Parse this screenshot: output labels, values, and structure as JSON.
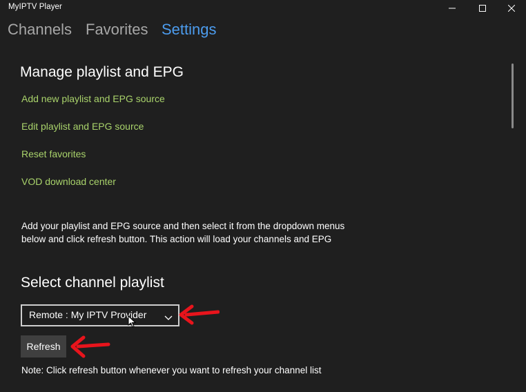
{
  "window": {
    "title": "MyIPTV Player",
    "controls": [
      "minimize-icon",
      "maximize-icon",
      "close-icon"
    ]
  },
  "nav": {
    "tabs": [
      {
        "label": "Channels",
        "active": false
      },
      {
        "label": "Favorites",
        "active": false
      },
      {
        "label": "Settings",
        "active": true
      }
    ]
  },
  "manage": {
    "title": "Manage playlist and EPG",
    "links": [
      "Add new playlist and EPG source",
      "Edit playlist and EPG source",
      "Reset favorites",
      "VOD download center"
    ]
  },
  "info": {
    "text": "Add your playlist and EPG source and then select it from the dropdown menus below and click refresh button. This action will load your channels and EPG"
  },
  "select_playlist": {
    "title": "Select channel playlist",
    "dropdown_value": "Remote : My IPTV Provider",
    "refresh_label": "Refresh",
    "note": "Note: Click refresh button whenever you want to refresh your channel list"
  },
  "colors": {
    "background": "#1f1f1f",
    "accent_active_tab": "#4c9cee",
    "inactive_tab": "#a7a7a7",
    "link": "#a9d36b",
    "button_bg": "#3f3f3f",
    "annotation_arrow": "#e8141c"
  }
}
